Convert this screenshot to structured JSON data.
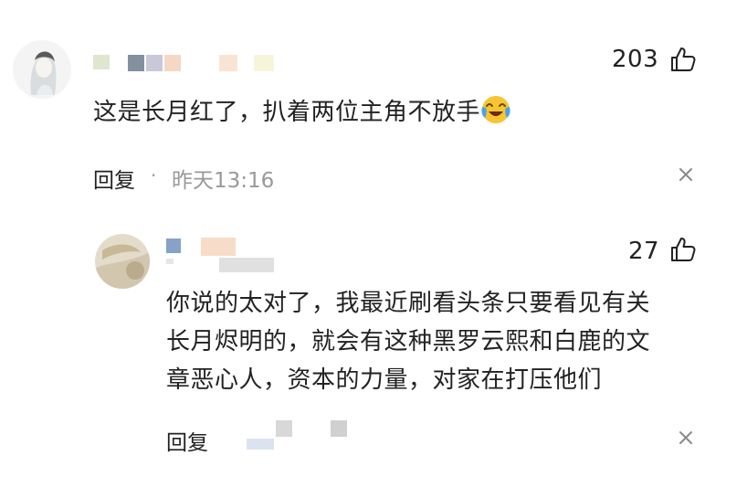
{
  "colors": {
    "text": "#222222",
    "meta": "#999999",
    "close": "#888888"
  },
  "comment": {
    "like_count": "203",
    "text": "这是长月红了，扒着两位主角不放手",
    "emoji_icon": "crying-laughing-emoji",
    "reply_label": "回复",
    "dot": "·",
    "time": "昨天13:16",
    "close_icon": "close-icon"
  },
  "reply": {
    "like_count": "27",
    "lines": [
      "你说的太对了，我最近刷看头条只要看见有关",
      "长月烬明的，就会有这种黑罗云熙和白鹿的文",
      "章恶心人，资本的力量，对家在打压他们"
    ],
    "reply_label": "回复",
    "close_icon": "close-icon"
  }
}
